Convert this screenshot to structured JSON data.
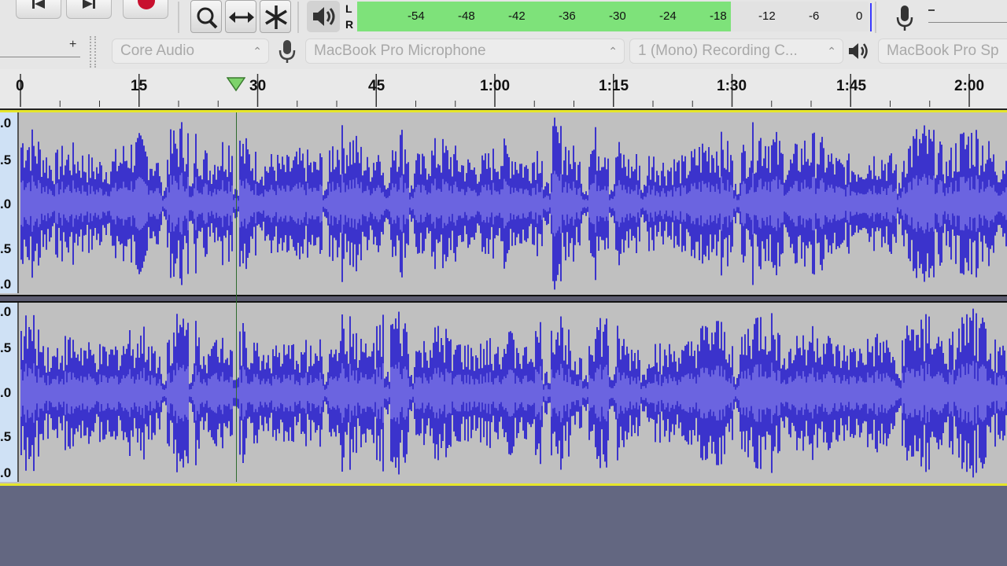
{
  "meter": {
    "channel_left": "L",
    "channel_right": "R",
    "ticks": [
      "-54",
      "-48",
      "-42",
      "-36",
      "-30",
      "-24",
      "-18",
      "-12",
      "-6",
      "0"
    ],
    "level_fraction": 0.73,
    "colors": {
      "level": "#7ee27a",
      "peak": "#3a3aff"
    }
  },
  "devices": {
    "host": "Core Audio",
    "recording_device": "MacBook Pro Microphone",
    "recording_channels": "1 (Mono) Recording C...",
    "playback_device": "MacBook Pro Sp"
  },
  "ruler": {
    "labels": [
      "0",
      "15",
      "30",
      "45",
      "1:00",
      "1:15",
      "1:30",
      "1:45",
      "2:00"
    ],
    "playhead_seconds": 27
  },
  "tracks": {
    "scale_labels": [
      ".0",
      ".5",
      ".0",
      ".5",
      ".0"
    ],
    "colors": {
      "waveform": "#3b33cc",
      "rms": "#6b64e0",
      "background": "#c0c0c0"
    }
  }
}
